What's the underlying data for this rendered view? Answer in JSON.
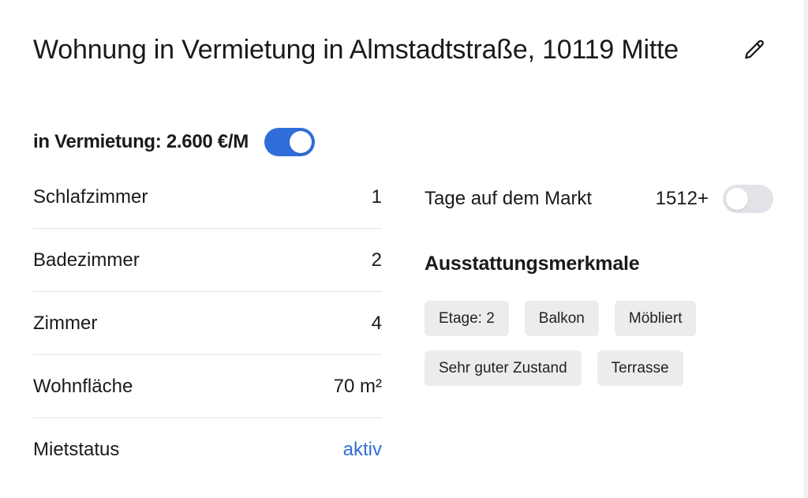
{
  "listing": {
    "title": "Wohnung in Vermietung in Almstadtstraße, 10119 Mitte",
    "price_label": "in Vermietung: 2.600 €/M",
    "price_toggle_on": true
  },
  "details": [
    {
      "label": "Schlafzimmer",
      "value": "1"
    },
    {
      "label": "Badezimmer",
      "value": "2"
    },
    {
      "label": "Zimmer",
      "value": "4"
    },
    {
      "label": "Wohnfläche",
      "value": "70 m²"
    },
    {
      "label": "Mietstatus",
      "value": "aktiv"
    }
  ],
  "market": {
    "label": "Tage auf dem Markt",
    "value": "1512+",
    "toggle_on": false
  },
  "features": {
    "title": "Ausstattungsmerkmale",
    "chips": [
      "Etage: 2",
      "Balkon",
      "Möbliert",
      "Sehr guter Zustand",
      "Terrasse"
    ]
  },
  "icons": {
    "edit": "pencil-icon"
  },
  "colors": {
    "accent": "#2f6ed8",
    "toggle_off": "#e1e3e8",
    "chip_bg": "#ececec"
  }
}
